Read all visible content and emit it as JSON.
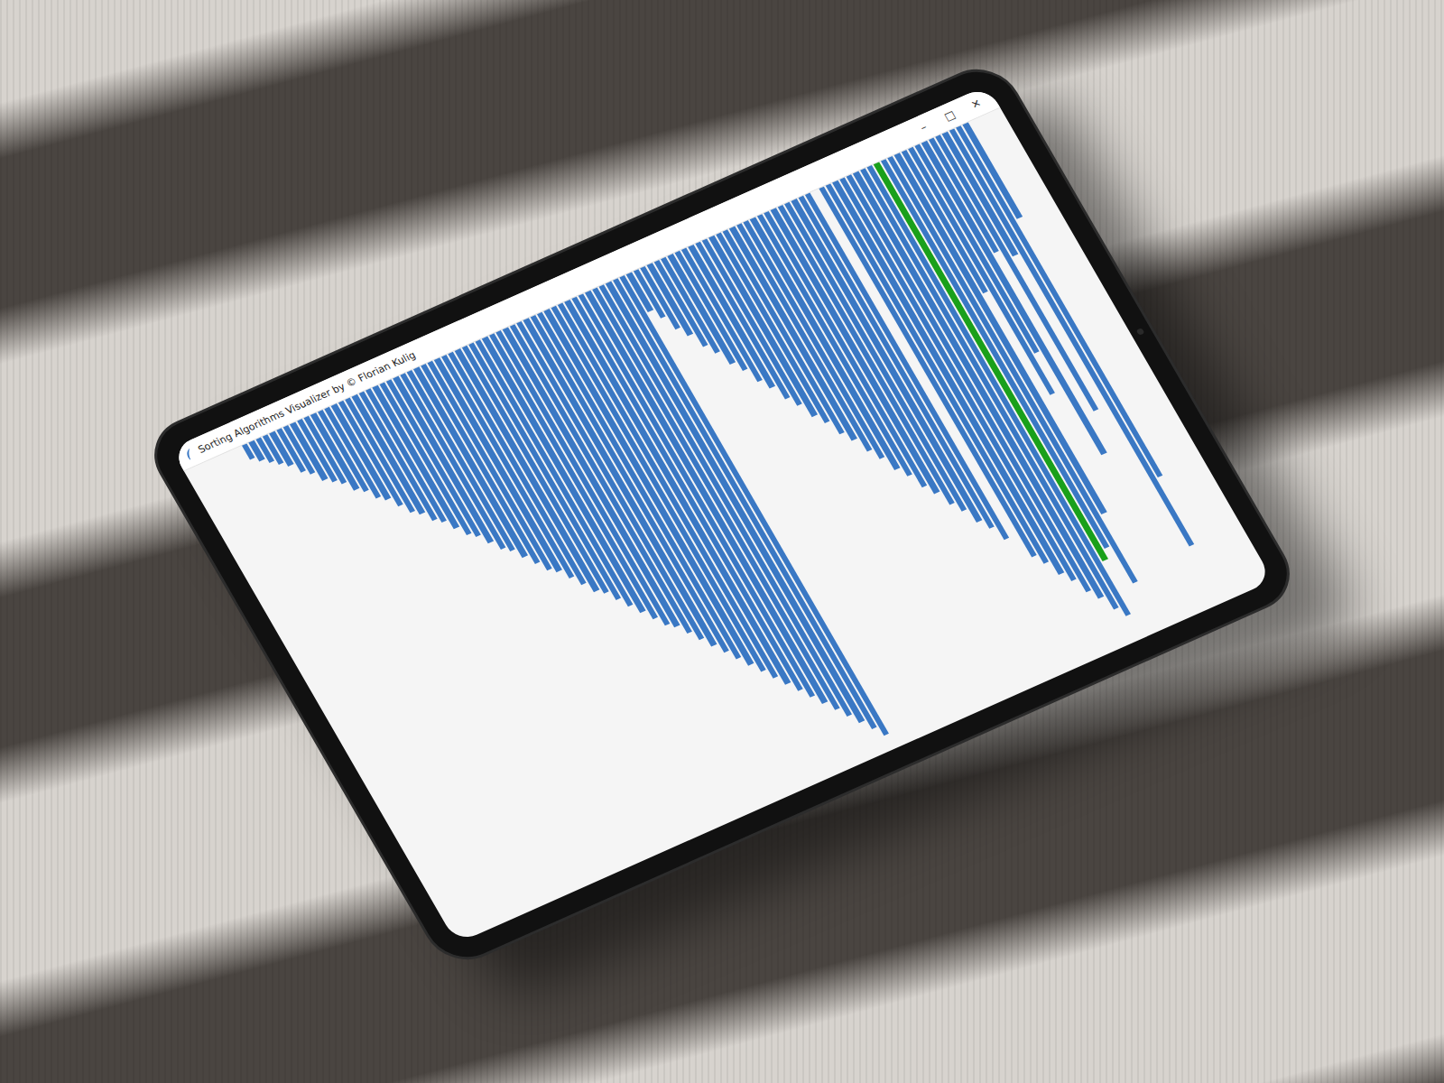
{
  "window": {
    "title": "Sorting Algorithms Visualizer by © Florian Kulig",
    "controls": [
      "–",
      "□",
      "✕"
    ]
  },
  "chart": {
    "bars": [
      {
        "value": 3,
        "selected": false
      },
      {
        "value": 4,
        "selected": false
      },
      {
        "value": 5,
        "selected": false
      },
      {
        "value": 6,
        "selected": false
      },
      {
        "value": 7,
        "selected": false
      },
      {
        "value": 9,
        "selected": false
      },
      {
        "value": 10,
        "selected": false
      },
      {
        "value": 12,
        "selected": false
      },
      {
        "value": 13,
        "selected": false
      },
      {
        "value": 14,
        "selected": false
      },
      {
        "value": 16,
        "selected": false
      },
      {
        "value": 17,
        "selected": false
      },
      {
        "value": 19,
        "selected": false
      },
      {
        "value": 20,
        "selected": false
      },
      {
        "value": 22,
        "selected": false
      },
      {
        "value": 24,
        "selected": false
      },
      {
        "value": 25,
        "selected": false
      },
      {
        "value": 27,
        "selected": false
      },
      {
        "value": 28,
        "selected": false
      },
      {
        "value": 30,
        "selected": false
      },
      {
        "value": 32,
        "selected": false
      },
      {
        "value": 33,
        "selected": false
      },
      {
        "value": 35,
        "selected": false
      },
      {
        "value": 37,
        "selected": false
      },
      {
        "value": 38,
        "selected": false
      },
      {
        "value": 40,
        "selected": false
      },
      {
        "value": 42,
        "selected": false
      },
      {
        "value": 44,
        "selected": false
      },
      {
        "value": 45,
        "selected": false
      },
      {
        "value": 47,
        "selected": false
      },
      {
        "value": 49,
        "selected": false
      },
      {
        "value": 51,
        "selected": false
      },
      {
        "value": 52,
        "selected": false
      },
      {
        "value": 54,
        "selected": false
      },
      {
        "value": 56,
        "selected": false
      },
      {
        "value": 58,
        "selected": false
      },
      {
        "value": 60,
        "selected": false
      },
      {
        "value": 62,
        "selected": false
      },
      {
        "value": 63,
        "selected": false
      },
      {
        "value": 65,
        "selected": false
      },
      {
        "value": 67,
        "selected": false
      },
      {
        "value": 69,
        "selected": false
      },
      {
        "value": 71,
        "selected": false
      },
      {
        "value": 73,
        "selected": false
      },
      {
        "value": 75,
        "selected": false
      },
      {
        "value": 77,
        "selected": false
      },
      {
        "value": 79,
        "selected": false
      },
      {
        "value": 81,
        "selected": false
      },
      {
        "value": 83,
        "selected": false
      },
      {
        "value": 85,
        "selected": false
      },
      {
        "value": 87,
        "selected": false
      },
      {
        "value": 89,
        "selected": false
      },
      {
        "value": 91,
        "selected": false
      },
      {
        "value": 93,
        "selected": false
      },
      {
        "value": 95,
        "selected": false
      },
      {
        "value": 97,
        "selected": false
      },
      {
        "value": 8,
        "selected": false
      },
      {
        "value": 10,
        "selected": false
      },
      {
        "value": 13,
        "selected": false
      },
      {
        "value": 15,
        "selected": false
      },
      {
        "value": 18,
        "selected": false
      },
      {
        "value": 20,
        "selected": false
      },
      {
        "value": 23,
        "selected": false
      },
      {
        "value": 25,
        "selected": false
      },
      {
        "value": 28,
        "selected": false
      },
      {
        "value": 30,
        "selected": false
      },
      {
        "value": 33,
        "selected": false
      },
      {
        "value": 35,
        "selected": false
      },
      {
        "value": 38,
        "selected": false
      },
      {
        "value": 40,
        "selected": false
      },
      {
        "value": 43,
        "selected": false
      },
      {
        "value": 45,
        "selected": false
      },
      {
        "value": 48,
        "selected": false
      },
      {
        "value": 50,
        "selected": false
      },
      {
        "value": 53,
        "selected": false
      },
      {
        "value": 55,
        "selected": false
      },
      {
        "value": 58,
        "selected": false
      },
      {
        "value": 60,
        "selected": false
      },
      {
        "value": 63,
        "selected": false
      },
      {
        "value": 65,
        "selected": false
      },
      {
        "value": 68,
        "selected": false
      },
      {
        "value": 70,
        "selected": false
      },
      {
        "value": 73,
        "selected": false
      },
      {
        "value": 0,
        "selected": false
      },
      {
        "value": 78,
        "selected": false
      },
      {
        "value": 80,
        "selected": false
      },
      {
        "value": 83,
        "selected": false
      },
      {
        "value": 85,
        "selected": false
      },
      {
        "value": 88,
        "selected": false
      },
      {
        "value": 90,
        "selected": false
      },
      {
        "value": 93,
        "selected": false
      },
      {
        "value": 95,
        "selected": false
      },
      {
        "value": 84,
        "selected": true
      },
      {
        "value": 82,
        "selected": false
      },
      {
        "value": 90,
        "selected": false
      },
      {
        "value": 76,
        "selected": false
      },
      {
        "value": 30,
        "selected": false
      },
      {
        "value": 52,
        "selected": false
      },
      {
        "value": 44,
        "selected": false
      },
      {
        "value": 66,
        "selected": false
      },
      {
        "value": 24,
        "selected": false
      },
      {
        "value": 58,
        "selected": false
      },
      {
        "value": 26,
        "selected": false
      },
      {
        "value": 88,
        "selected": false
      },
      {
        "value": 74,
        "selected": false
      },
      {
        "value": 20,
        "selected": false
      }
    ]
  }
}
